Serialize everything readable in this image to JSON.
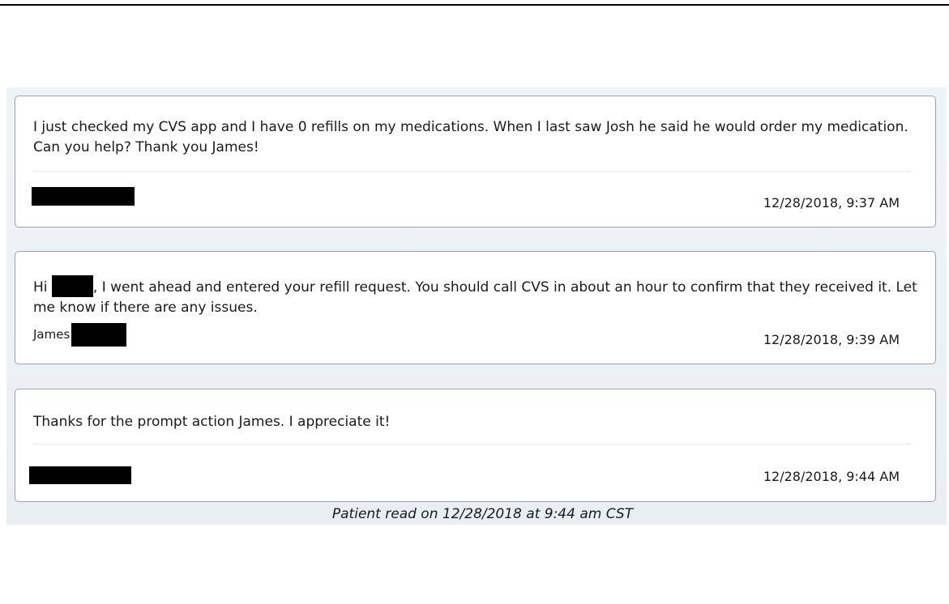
{
  "messages": [
    {
      "text": "I just checked my CVS app and I have 0 refills on my medications. When I last saw Josh he said he would order my medication. Can you help? Thank you James!",
      "timestamp": "12/28/2018, 9:37 AM"
    },
    {
      "text_before": "Hi",
      "text_after": ", I went ahead and entered your refill request. You should call CVS in about an hour to confirm that they received it. Let me know if there are any issues.",
      "signer": "James",
      "timestamp": "12/28/2018, 9:39 AM"
    },
    {
      "text": "Thanks for the prompt action James. I appreciate it!",
      "timestamp": "12/28/2018, 9:44 AM"
    }
  ],
  "read_receipt": "Patient read on 12/28/2018 at 9:44 am CST"
}
